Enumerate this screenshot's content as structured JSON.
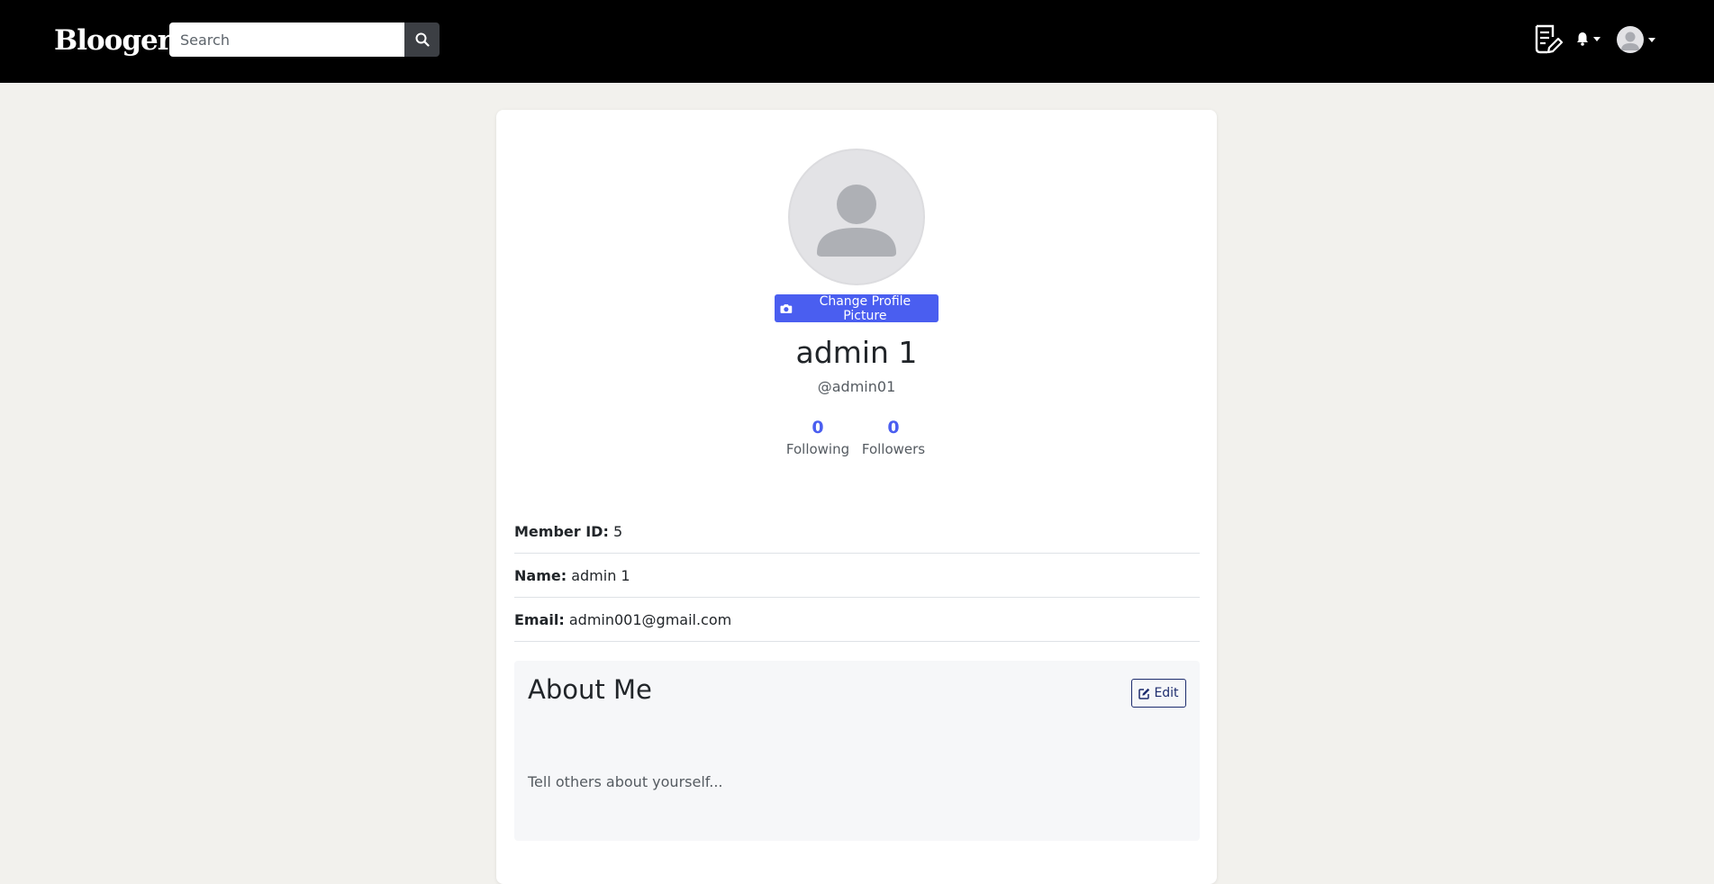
{
  "navbar": {
    "brand": "Blooger.",
    "search_placeholder": "Search",
    "icons": {
      "search": "search-icon",
      "write": "write-post-icon",
      "notifications": "bell-icon",
      "account": "user-avatar"
    }
  },
  "profile": {
    "change_picture_label": "Change Profile Picture",
    "name": "admin 1",
    "handle": "@admin01",
    "following_count": "0",
    "following_label": "Following",
    "followers_count": "0",
    "followers_label": "Followers"
  },
  "details": {
    "member_id_label": "Member ID:",
    "member_id_value": "5",
    "name_label": "Name:",
    "name_value": "admin 1",
    "email_label": "Email:",
    "email_value": "admin001@gmail.com"
  },
  "about": {
    "title": "About Me",
    "edit_label": "Edit",
    "placeholder_text": "Tell others about yourself..."
  },
  "colors": {
    "navbar_bg": "#000000",
    "page_bg": "#f2f1ed",
    "accent": "#4a5ef0",
    "edit_outline": "#1d2c6e"
  }
}
